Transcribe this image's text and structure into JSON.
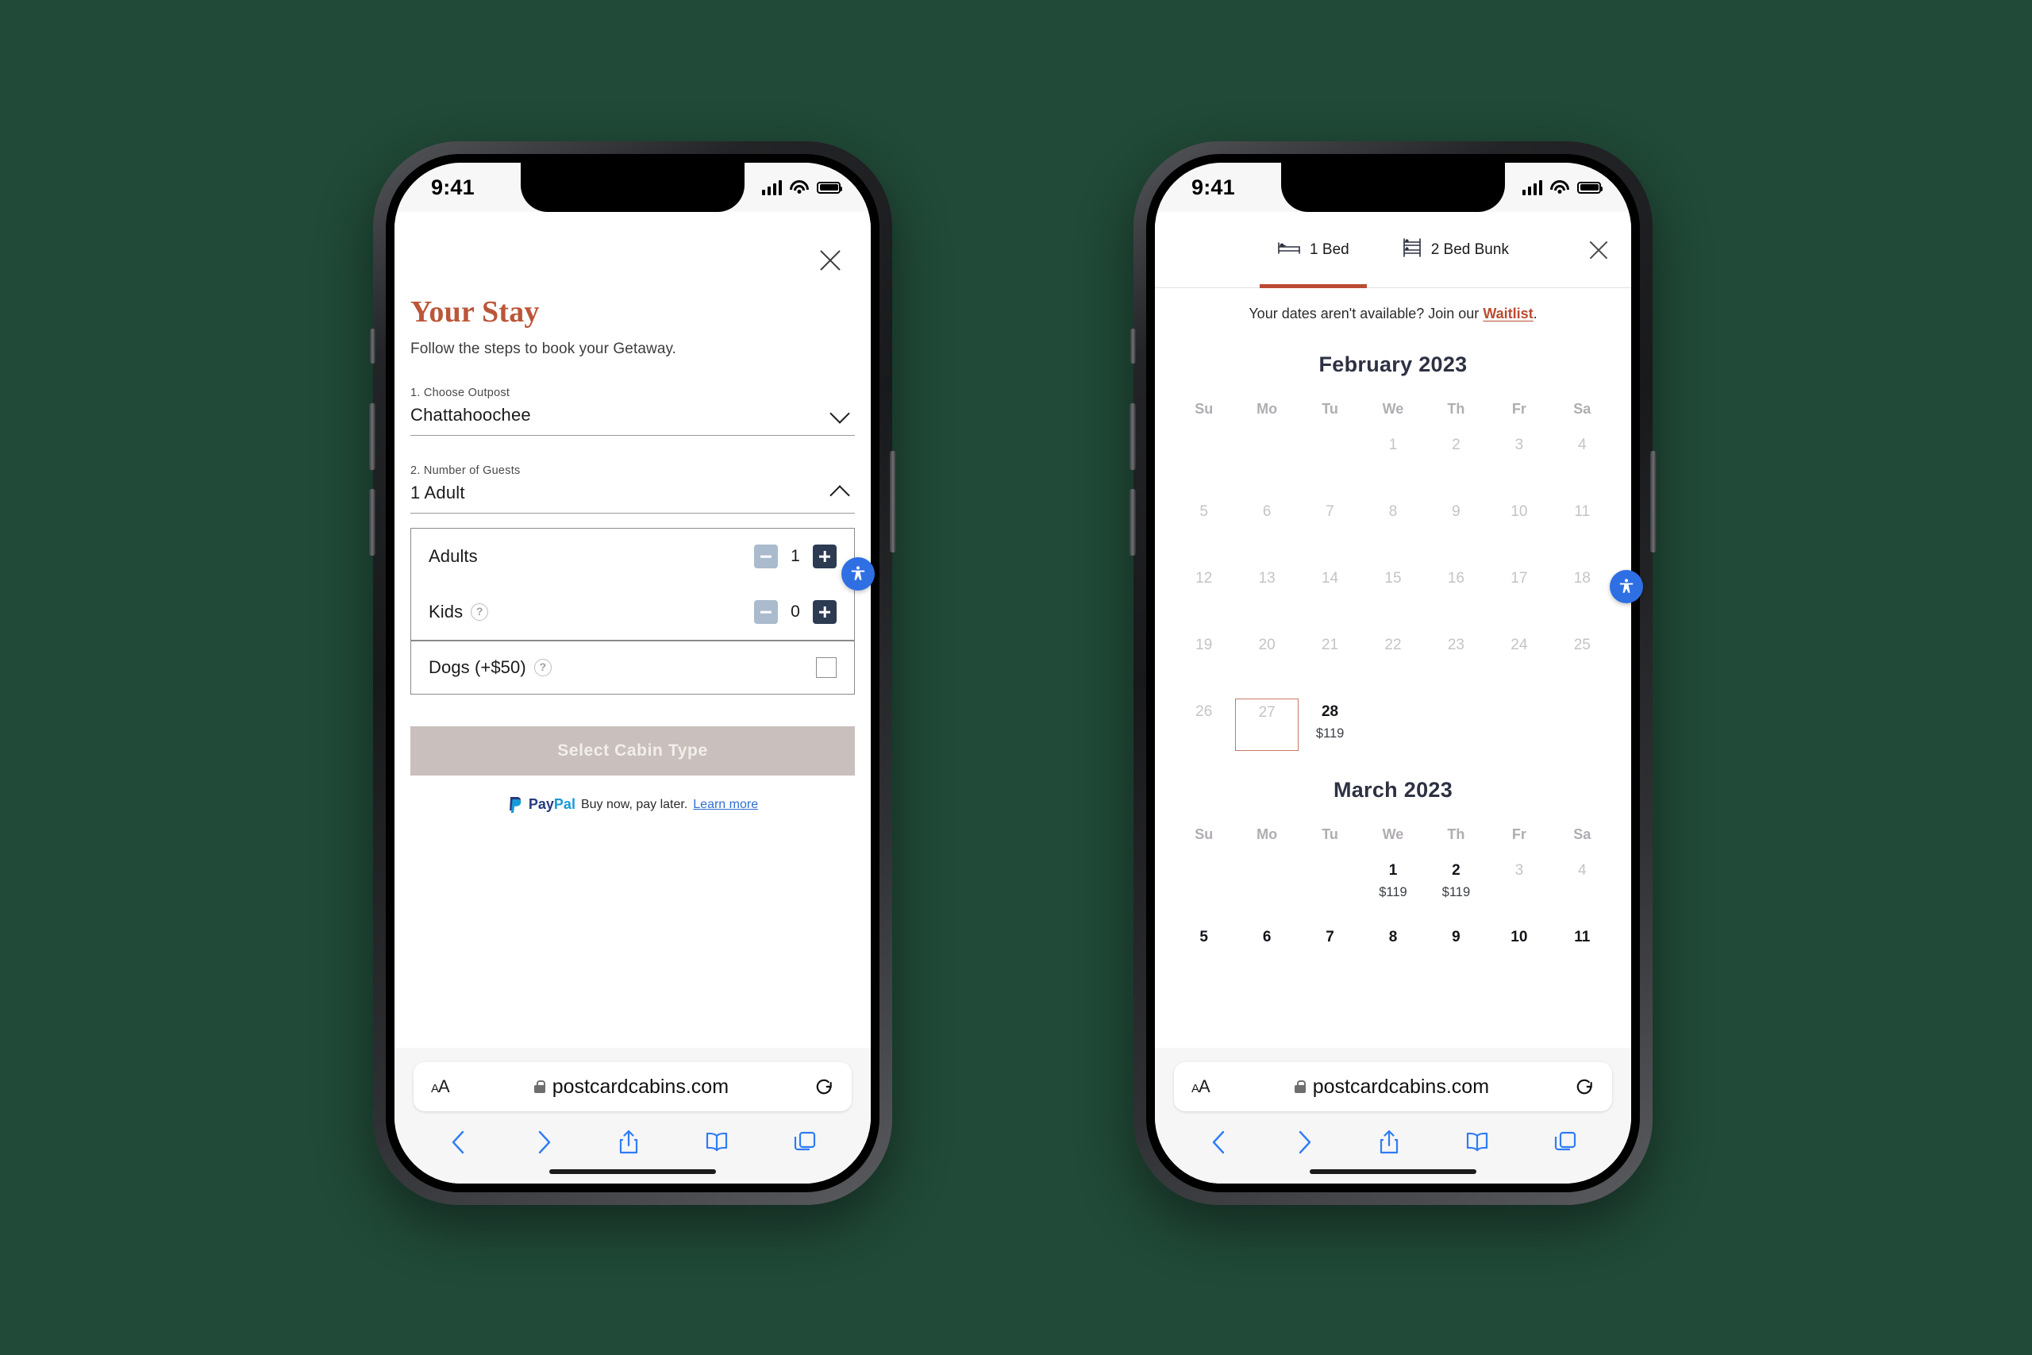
{
  "background_color": "#214a38",
  "accent_red": "#bb5638",
  "status_bar": {
    "time": "9:41",
    "signal_icon": "cellular-signal-icon",
    "wifi_icon": "wifi-icon",
    "battery_icon": "battery-icon"
  },
  "safari": {
    "text_size_label": "AA",
    "lock_icon": "lock-icon",
    "url": "postcardcabins.com",
    "reload_icon": "reload-icon",
    "back_icon": "back-chevron-icon",
    "forward_icon": "forward-chevron-icon",
    "share_icon": "share-icon",
    "bookmarks_icon": "book-icon",
    "tabs_icon": "tabs-icon"
  },
  "accessibility_widget": {
    "icon": "accessibility-person-icon",
    "color": "#2f6fe4"
  },
  "left_phone": {
    "close_icon": "close-icon",
    "title": "Your Stay",
    "subtitle": "Follow the steps to book your Getaway.",
    "fields": [
      {
        "label": "1. Choose Outpost",
        "value": "Chattahoochee",
        "chevron": "chevron-down-icon",
        "expanded": false
      },
      {
        "label": "2. Number of Guests",
        "value": "1 Adult",
        "chevron": "chevron-up-icon",
        "expanded": true
      }
    ],
    "guest_rows": [
      {
        "name": "Adults",
        "has_help": false,
        "count": "1",
        "minus_icon": "minus-icon",
        "plus_icon": "plus-icon"
      },
      {
        "name": "Kids",
        "has_help": true,
        "help_icon": "help-circle-icon",
        "count": "0",
        "minus_icon": "minus-icon",
        "plus_icon": "plus-icon"
      }
    ],
    "dogs_row": {
      "name": "Dogs (+$50)",
      "help_icon": "help-circle-icon",
      "checkbox": "checkbox-unchecked-icon"
    },
    "cta_label": "Select Cabin Type",
    "paypal": {
      "brand_first": "Pay",
      "brand_second": "Pal",
      "message": "Buy now, pay later.",
      "link": "Learn more"
    }
  },
  "right_phone": {
    "tabs": [
      {
        "label": "1 Bed",
        "icon": "single-bed-icon",
        "active": true
      },
      {
        "label": "2 Bed Bunk",
        "icon": "bunk-bed-icon",
        "active": false
      }
    ],
    "close_icon": "close-icon",
    "waitlist_prefix": "Your dates aren't available? Join our ",
    "waitlist_link": "Waitlist",
    "waitlist_suffix": ".",
    "day_headers": [
      "Su",
      "Mo",
      "Tu",
      "We",
      "Th",
      "Fr",
      "Sa"
    ],
    "months": [
      {
        "title": "February 2023",
        "weeks": [
          [
            {
              "num": "",
              "state": "empty"
            },
            {
              "num": "",
              "state": "empty"
            },
            {
              "num": "",
              "state": "empty"
            },
            {
              "num": "1",
              "state": "disabled"
            },
            {
              "num": "2",
              "state": "disabled"
            },
            {
              "num": "3",
              "state": "disabled"
            },
            {
              "num": "4",
              "state": "disabled"
            }
          ],
          [
            {
              "num": "5",
              "state": "disabled"
            },
            {
              "num": "6",
              "state": "disabled"
            },
            {
              "num": "7",
              "state": "disabled"
            },
            {
              "num": "8",
              "state": "disabled"
            },
            {
              "num": "9",
              "state": "disabled"
            },
            {
              "num": "10",
              "state": "disabled"
            },
            {
              "num": "11",
              "state": "disabled"
            }
          ],
          [
            {
              "num": "12",
              "state": "disabled"
            },
            {
              "num": "13",
              "state": "disabled"
            },
            {
              "num": "14",
              "state": "disabled"
            },
            {
              "num": "15",
              "state": "disabled"
            },
            {
              "num": "16",
              "state": "disabled"
            },
            {
              "num": "17",
              "state": "disabled"
            },
            {
              "num": "18",
              "state": "disabled"
            }
          ],
          [
            {
              "num": "19",
              "state": "disabled"
            },
            {
              "num": "20",
              "state": "disabled"
            },
            {
              "num": "21",
              "state": "disabled"
            },
            {
              "num": "22",
              "state": "disabled"
            },
            {
              "num": "23",
              "state": "disabled"
            },
            {
              "num": "24",
              "state": "disabled"
            },
            {
              "num": "25",
              "state": "disabled"
            }
          ],
          [
            {
              "num": "26",
              "state": "disabled"
            },
            {
              "num": "27",
              "state": "outlined"
            },
            {
              "num": "28",
              "state": "available",
              "price": "$119"
            },
            {
              "num": "",
              "state": "empty"
            },
            {
              "num": "",
              "state": "empty"
            },
            {
              "num": "",
              "state": "empty"
            },
            {
              "num": "",
              "state": "empty"
            }
          ]
        ]
      },
      {
        "title": "March 2023",
        "weeks": [
          [
            {
              "num": "",
              "state": "empty"
            },
            {
              "num": "",
              "state": "empty"
            },
            {
              "num": "",
              "state": "empty"
            },
            {
              "num": "1",
              "state": "available",
              "price": "$119"
            },
            {
              "num": "2",
              "state": "available",
              "price": "$119"
            },
            {
              "num": "3",
              "state": "disabled"
            },
            {
              "num": "4",
              "state": "disabled"
            }
          ],
          [
            {
              "num": "5",
              "state": "available"
            },
            {
              "num": "6",
              "state": "available"
            },
            {
              "num": "7",
              "state": "available"
            },
            {
              "num": "8",
              "state": "available"
            },
            {
              "num": "9",
              "state": "available"
            },
            {
              "num": "10",
              "state": "available"
            },
            {
              "num": "11",
              "state": "available"
            }
          ]
        ]
      }
    ]
  }
}
